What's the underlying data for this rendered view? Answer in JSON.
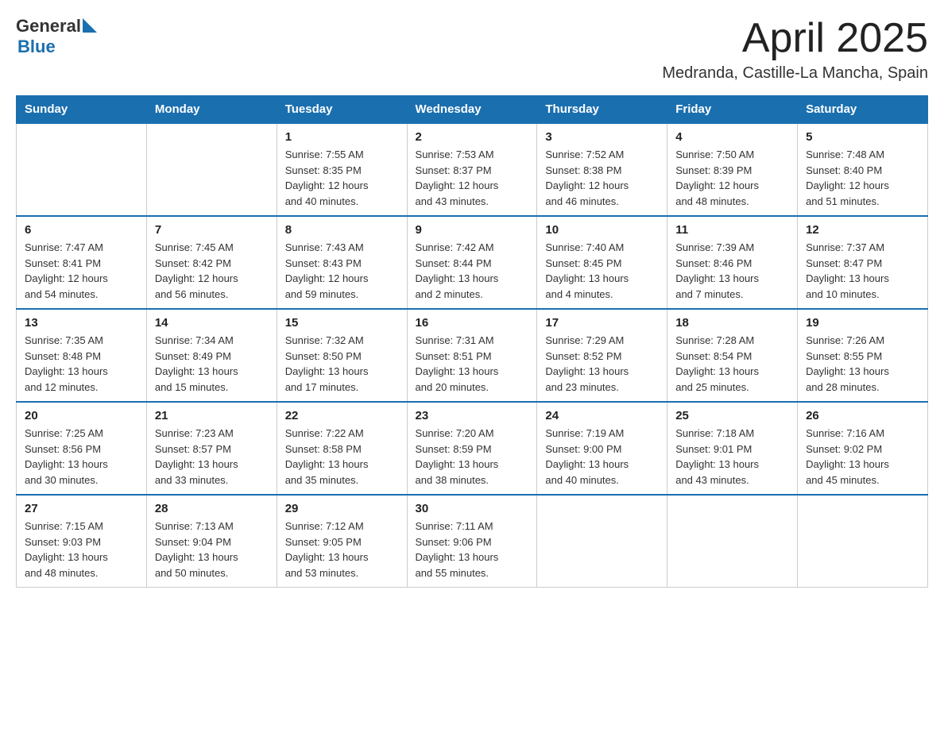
{
  "header": {
    "logo_general": "General",
    "logo_blue": "Blue",
    "month_year": "April 2025",
    "location": "Medranda, Castille-La Mancha, Spain"
  },
  "weekdays": [
    "Sunday",
    "Monday",
    "Tuesday",
    "Wednesday",
    "Thursday",
    "Friday",
    "Saturday"
  ],
  "weeks": [
    [
      {
        "day": "",
        "info": ""
      },
      {
        "day": "",
        "info": ""
      },
      {
        "day": "1",
        "info": "Sunrise: 7:55 AM\nSunset: 8:35 PM\nDaylight: 12 hours\nand 40 minutes."
      },
      {
        "day": "2",
        "info": "Sunrise: 7:53 AM\nSunset: 8:37 PM\nDaylight: 12 hours\nand 43 minutes."
      },
      {
        "day": "3",
        "info": "Sunrise: 7:52 AM\nSunset: 8:38 PM\nDaylight: 12 hours\nand 46 minutes."
      },
      {
        "day": "4",
        "info": "Sunrise: 7:50 AM\nSunset: 8:39 PM\nDaylight: 12 hours\nand 48 minutes."
      },
      {
        "day": "5",
        "info": "Sunrise: 7:48 AM\nSunset: 8:40 PM\nDaylight: 12 hours\nand 51 minutes."
      }
    ],
    [
      {
        "day": "6",
        "info": "Sunrise: 7:47 AM\nSunset: 8:41 PM\nDaylight: 12 hours\nand 54 minutes."
      },
      {
        "day": "7",
        "info": "Sunrise: 7:45 AM\nSunset: 8:42 PM\nDaylight: 12 hours\nand 56 minutes."
      },
      {
        "day": "8",
        "info": "Sunrise: 7:43 AM\nSunset: 8:43 PM\nDaylight: 12 hours\nand 59 minutes."
      },
      {
        "day": "9",
        "info": "Sunrise: 7:42 AM\nSunset: 8:44 PM\nDaylight: 13 hours\nand 2 minutes."
      },
      {
        "day": "10",
        "info": "Sunrise: 7:40 AM\nSunset: 8:45 PM\nDaylight: 13 hours\nand 4 minutes."
      },
      {
        "day": "11",
        "info": "Sunrise: 7:39 AM\nSunset: 8:46 PM\nDaylight: 13 hours\nand 7 minutes."
      },
      {
        "day": "12",
        "info": "Sunrise: 7:37 AM\nSunset: 8:47 PM\nDaylight: 13 hours\nand 10 minutes."
      }
    ],
    [
      {
        "day": "13",
        "info": "Sunrise: 7:35 AM\nSunset: 8:48 PM\nDaylight: 13 hours\nand 12 minutes."
      },
      {
        "day": "14",
        "info": "Sunrise: 7:34 AM\nSunset: 8:49 PM\nDaylight: 13 hours\nand 15 minutes."
      },
      {
        "day": "15",
        "info": "Sunrise: 7:32 AM\nSunset: 8:50 PM\nDaylight: 13 hours\nand 17 minutes."
      },
      {
        "day": "16",
        "info": "Sunrise: 7:31 AM\nSunset: 8:51 PM\nDaylight: 13 hours\nand 20 minutes."
      },
      {
        "day": "17",
        "info": "Sunrise: 7:29 AM\nSunset: 8:52 PM\nDaylight: 13 hours\nand 23 minutes."
      },
      {
        "day": "18",
        "info": "Sunrise: 7:28 AM\nSunset: 8:54 PM\nDaylight: 13 hours\nand 25 minutes."
      },
      {
        "day": "19",
        "info": "Sunrise: 7:26 AM\nSunset: 8:55 PM\nDaylight: 13 hours\nand 28 minutes."
      }
    ],
    [
      {
        "day": "20",
        "info": "Sunrise: 7:25 AM\nSunset: 8:56 PM\nDaylight: 13 hours\nand 30 minutes."
      },
      {
        "day": "21",
        "info": "Sunrise: 7:23 AM\nSunset: 8:57 PM\nDaylight: 13 hours\nand 33 minutes."
      },
      {
        "day": "22",
        "info": "Sunrise: 7:22 AM\nSunset: 8:58 PM\nDaylight: 13 hours\nand 35 minutes."
      },
      {
        "day": "23",
        "info": "Sunrise: 7:20 AM\nSunset: 8:59 PM\nDaylight: 13 hours\nand 38 minutes."
      },
      {
        "day": "24",
        "info": "Sunrise: 7:19 AM\nSunset: 9:00 PM\nDaylight: 13 hours\nand 40 minutes."
      },
      {
        "day": "25",
        "info": "Sunrise: 7:18 AM\nSunset: 9:01 PM\nDaylight: 13 hours\nand 43 minutes."
      },
      {
        "day": "26",
        "info": "Sunrise: 7:16 AM\nSunset: 9:02 PM\nDaylight: 13 hours\nand 45 minutes."
      }
    ],
    [
      {
        "day": "27",
        "info": "Sunrise: 7:15 AM\nSunset: 9:03 PM\nDaylight: 13 hours\nand 48 minutes."
      },
      {
        "day": "28",
        "info": "Sunrise: 7:13 AM\nSunset: 9:04 PM\nDaylight: 13 hours\nand 50 minutes."
      },
      {
        "day": "29",
        "info": "Sunrise: 7:12 AM\nSunset: 9:05 PM\nDaylight: 13 hours\nand 53 minutes."
      },
      {
        "day": "30",
        "info": "Sunrise: 7:11 AM\nSunset: 9:06 PM\nDaylight: 13 hours\nand 55 minutes."
      },
      {
        "day": "",
        "info": ""
      },
      {
        "day": "",
        "info": ""
      },
      {
        "day": "",
        "info": ""
      }
    ]
  ]
}
